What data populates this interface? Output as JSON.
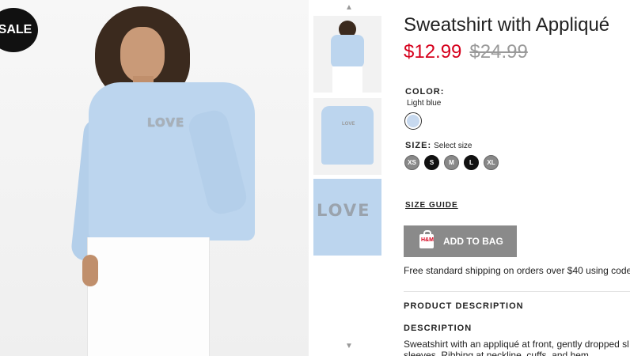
{
  "badge": {
    "sale": "SALE"
  },
  "main_image": {
    "print_text": "LOVE"
  },
  "thumbnails": {
    "print_text": "LOVE"
  },
  "product": {
    "title": "Sweatshirt with Appliqué",
    "price_current": "$12.99",
    "price_original": "$24.99",
    "color_label": "COLOR:",
    "color_value": "Light blue",
    "size_label": "SIZE:",
    "size_prompt": "Select size",
    "sizes": [
      "XS",
      "S",
      "M",
      "L",
      "XL"
    ],
    "size_guide": "SIZE GUIDE",
    "add_to_bag": "ADD TO BAG",
    "bag_icon_text": "H&M",
    "shipping": "Free standard shipping on orders over $40 using code",
    "product_description_heading": "PRODUCT DESCRIPTION",
    "description_heading": "DESCRIPTION",
    "description_text": "Sweatshirt with an appliqué at front, gently dropped sl sleeves. Ribbing at neckline, cuffs, and hem."
  },
  "colors": {
    "sale_price": "#d6001c",
    "add_to_bag_bg": "#8a8a8a",
    "swatch": "#c7d9ef"
  }
}
